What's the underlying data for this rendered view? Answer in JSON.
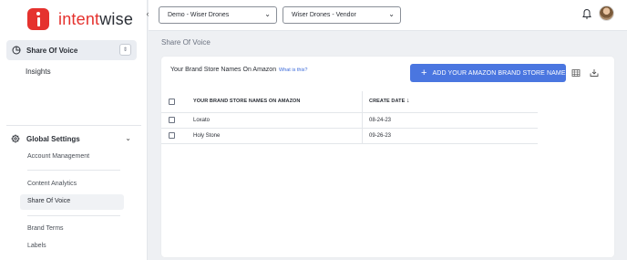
{
  "brand": {
    "name_prefix": "intent",
    "name_suffix": "wise"
  },
  "sidebar": {
    "active_section": "Share Of Voice",
    "insights": "Insights",
    "global_settings": "Global Settings",
    "sub_items": [
      {
        "label": "Account Management"
      },
      {
        "label": "Content Analytics"
      },
      {
        "label": "Share Of Voice"
      },
      {
        "label": "Brand Terms"
      },
      {
        "label": "Labels"
      }
    ]
  },
  "topbar": {
    "account_select": "Demo - Wiser Drones",
    "profile_select": "Wiser Drones - Vendor"
  },
  "main": {
    "page_title": "Share Of Voice",
    "card_title": "Your Brand Store Names On Amazon",
    "help_link": "What is this?",
    "add_button": "ADD YOUR AMAZON BRAND STORE NAME",
    "table": {
      "columns": [
        "YOUR BRAND STORE NAMES ON AMAZON",
        "CREATE DATE"
      ],
      "sort_indicator": "↓",
      "rows": [
        {
          "name": "Loxato",
          "date": "08-24-23"
        },
        {
          "name": "Holy Stone",
          "date": "09-26-23"
        }
      ]
    }
  },
  "colors": {
    "brand_red": "#e5322e",
    "primary_button": "#4a76e0",
    "link": "#3b6ad9"
  },
  "icons": {
    "collapse": "chevron-left-icon",
    "bell": "bell-icon",
    "pie": "pie-chart-icon",
    "gear": "gear-icon",
    "grid": "table-icon",
    "download": "download-icon"
  }
}
